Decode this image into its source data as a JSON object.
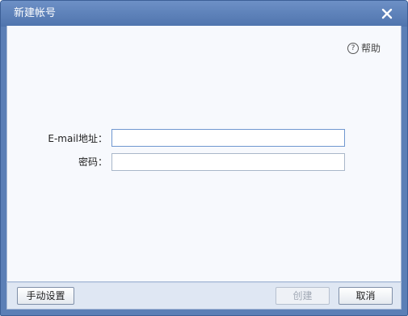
{
  "window": {
    "title": "新建帐号",
    "accent_color": "#5b7fb6",
    "close_icon": "close-icon"
  },
  "help": {
    "icon": "question-circle-icon",
    "label": "帮助"
  },
  "form": {
    "email_label": "E-mail地址：",
    "email_value": "",
    "password_label": "密码：",
    "password_value": ""
  },
  "footer": {
    "manual_setup_label": "手动设置",
    "create_label": "创建",
    "create_enabled": false,
    "cancel_label": "取消"
  }
}
